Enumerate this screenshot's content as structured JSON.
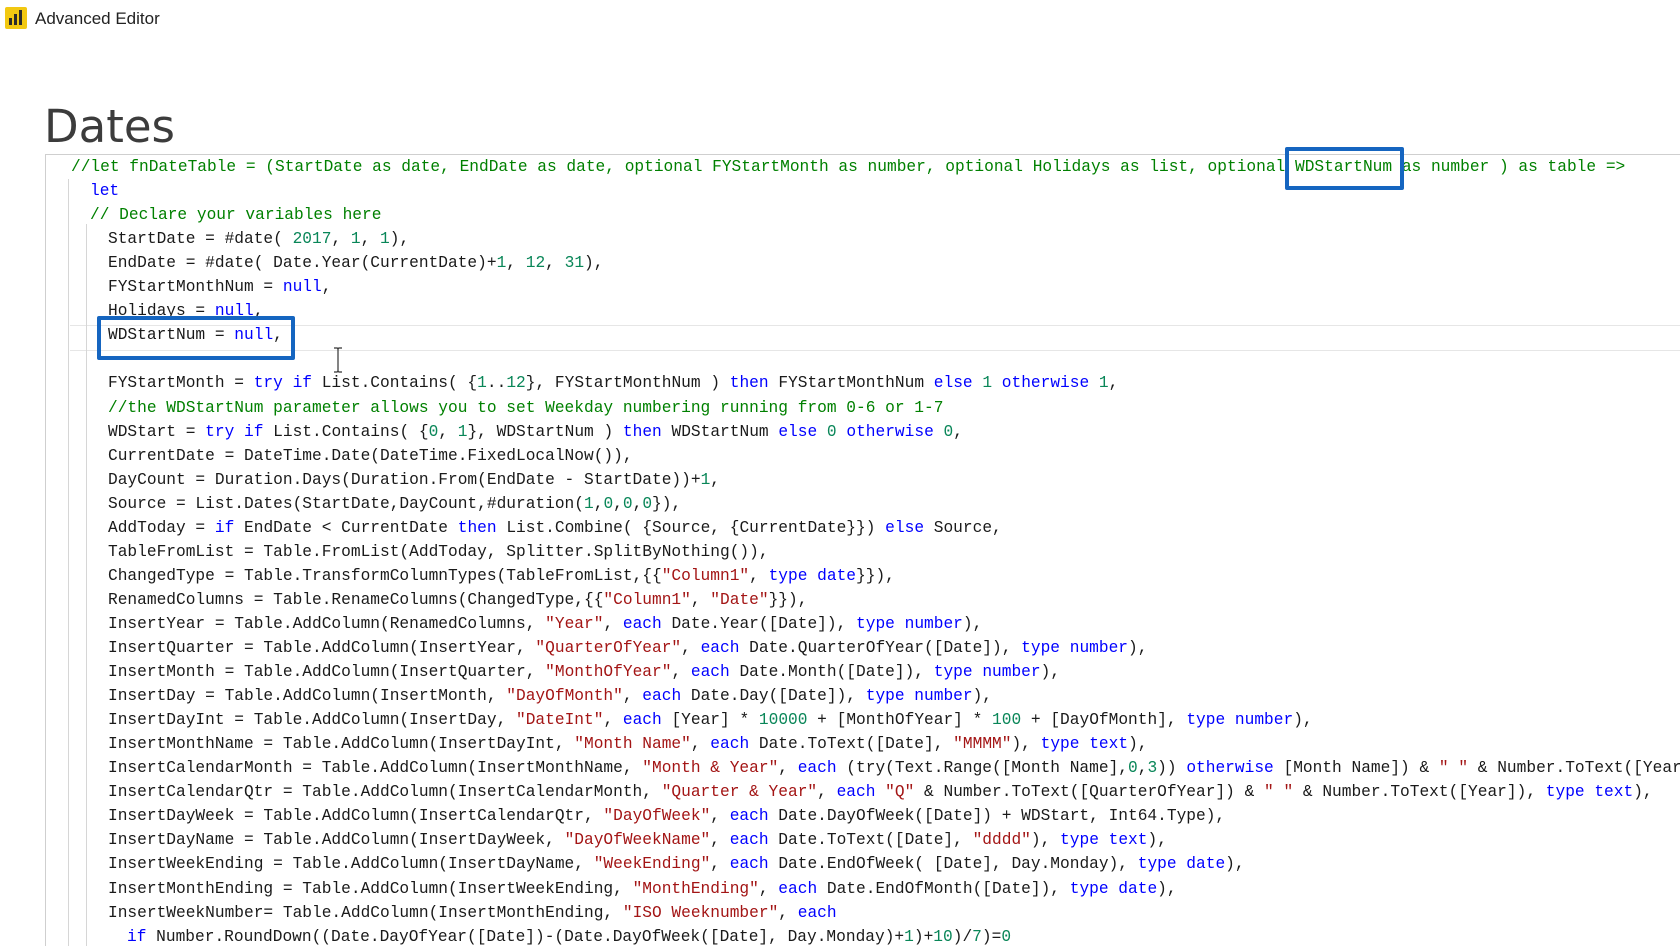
{
  "window": {
    "title": "Advanced Editor",
    "icon": "power-bi-icon",
    "accent_color": "#f2c811"
  },
  "page": {
    "title": "Dates"
  },
  "editor": {
    "highlight_color": "#1565c0",
    "lines": [
      {
        "indent": 0,
        "tokens": [
          [
            "cm",
            "//let fnDateTable = (StartDate as date, EndDate as date, optional FYStartMonth as number, optional Holidays as list, optional WDStartNum as number ) as table =>"
          ]
        ]
      },
      {
        "indent": 1,
        "tokens": [
          [
            "kw",
            "let"
          ]
        ]
      },
      {
        "indent": 1,
        "tokens": [
          [
            "cm",
            "// Declare your variables here"
          ]
        ]
      },
      {
        "indent": 2,
        "tokens": [
          [
            "tx",
            "StartDate = #date( "
          ],
          [
            "nm",
            "2017"
          ],
          [
            "tx",
            ", "
          ],
          [
            "nm",
            "1"
          ],
          [
            "tx",
            ", "
          ],
          [
            "nm",
            "1"
          ],
          [
            "tx",
            "),"
          ]
        ]
      },
      {
        "indent": 2,
        "tokens": [
          [
            "tx",
            "EndDate = #date( Date.Year(CurrentDate)+"
          ],
          [
            "nm",
            "1"
          ],
          [
            "tx",
            ", "
          ],
          [
            "nm",
            "12"
          ],
          [
            "tx",
            ", "
          ],
          [
            "nm",
            "31"
          ],
          [
            "tx",
            "),"
          ]
        ]
      },
      {
        "indent": 2,
        "tokens": [
          [
            "tx",
            "FYStartMonthNum = "
          ],
          [
            "kw",
            "null"
          ],
          [
            "tx",
            ","
          ]
        ]
      },
      {
        "indent": 2,
        "tokens": [
          [
            "tx",
            "Holidays = "
          ],
          [
            "kw",
            "null"
          ],
          [
            "tx",
            ","
          ]
        ]
      },
      {
        "indent": 2,
        "tokens": [
          [
            "tx",
            "WDStartNum = "
          ],
          [
            "kw",
            "null"
          ],
          [
            "tx",
            ","
          ]
        ]
      },
      {
        "indent": 2,
        "tokens": []
      },
      {
        "indent": 2,
        "tokens": [
          [
            "tx",
            "FYStartMonth = "
          ],
          [
            "kw",
            "try if "
          ],
          [
            "tx",
            "List.Contains( {"
          ],
          [
            "nm",
            "1"
          ],
          [
            "tx",
            ".."
          ],
          [
            "nm",
            "12"
          ],
          [
            "tx",
            "}, FYStartMonthNum ) "
          ],
          [
            "kw",
            "then "
          ],
          [
            "tx",
            "FYStartMonthNum "
          ],
          [
            "kw",
            "else "
          ],
          [
            "nm",
            "1"
          ],
          [
            "kw",
            " otherwise "
          ],
          [
            "nm",
            "1"
          ],
          [
            "tx",
            ","
          ]
        ]
      },
      {
        "indent": 2,
        "tokens": [
          [
            "cm",
            "//the WDStartNum parameter allows you to set Weekday numbering running from 0-6 or 1-7"
          ]
        ]
      },
      {
        "indent": 2,
        "tokens": [
          [
            "tx",
            "WDStart = "
          ],
          [
            "kw",
            "try if "
          ],
          [
            "tx",
            "List.Contains( {"
          ],
          [
            "nm",
            "0"
          ],
          [
            "tx",
            ", "
          ],
          [
            "nm",
            "1"
          ],
          [
            "tx",
            "}, WDStartNum ) "
          ],
          [
            "kw",
            "then "
          ],
          [
            "tx",
            "WDStartNum "
          ],
          [
            "kw",
            "else "
          ],
          [
            "nm",
            "0"
          ],
          [
            "kw",
            " otherwise "
          ],
          [
            "nm",
            "0"
          ],
          [
            "tx",
            ","
          ]
        ]
      },
      {
        "indent": 2,
        "tokens": [
          [
            "tx",
            "CurrentDate = DateTime.Date(DateTime.FixedLocalNow()),"
          ]
        ]
      },
      {
        "indent": 2,
        "tokens": [
          [
            "tx",
            "DayCount = Duration.Days(Duration.From(EndDate - StartDate))+"
          ],
          [
            "nm",
            "1"
          ],
          [
            "tx",
            ","
          ]
        ]
      },
      {
        "indent": 2,
        "tokens": [
          [
            "tx",
            "Source = List.Dates(StartDate,DayCount,#duration("
          ],
          [
            "nm",
            "1"
          ],
          [
            "tx",
            ","
          ],
          [
            "nm",
            "0"
          ],
          [
            "tx",
            ","
          ],
          [
            "nm",
            "0"
          ],
          [
            "tx",
            ","
          ],
          [
            "nm",
            "0"
          ],
          [
            "tx",
            "}),"
          ]
        ]
      },
      {
        "indent": 2,
        "tokens": [
          [
            "tx",
            "AddToday = "
          ],
          [
            "kw",
            "if "
          ],
          [
            "tx",
            "EndDate < CurrentDate "
          ],
          [
            "kw",
            "then "
          ],
          [
            "tx",
            "List.Combine( {Source, {CurrentDate}}) "
          ],
          [
            "kw",
            "else "
          ],
          [
            "tx",
            "Source,"
          ]
        ]
      },
      {
        "indent": 2,
        "tokens": [
          [
            "tx",
            "TableFromList = Table.FromList(AddToday, Splitter.SplitByNothing()),"
          ]
        ]
      },
      {
        "indent": 2,
        "tokens": [
          [
            "tx",
            "ChangedType = Table.TransformColumnTypes(TableFromList,{{"
          ],
          [
            "st",
            "\"Column1\""
          ],
          [
            "tx",
            ", "
          ],
          [
            "kw",
            "type date"
          ],
          [
            "tx",
            "}}),"
          ]
        ]
      },
      {
        "indent": 2,
        "tokens": [
          [
            "tx",
            "RenamedColumns = Table.RenameColumns(ChangedType,{{"
          ],
          [
            "st",
            "\"Column1\""
          ],
          [
            "tx",
            ", "
          ],
          [
            "st",
            "\"Date\""
          ],
          [
            "tx",
            "}}),"
          ]
        ]
      },
      {
        "indent": 2,
        "tokens": [
          [
            "tx",
            "InsertYear = Table.AddColumn(RenamedColumns, "
          ],
          [
            "st",
            "\"Year\""
          ],
          [
            "tx",
            ", "
          ],
          [
            "kw",
            "each "
          ],
          [
            "tx",
            "Date.Year([Date]), "
          ],
          [
            "kw",
            "type number"
          ],
          [
            "tx",
            "),"
          ]
        ]
      },
      {
        "indent": 2,
        "tokens": [
          [
            "tx",
            "InsertQuarter = Table.AddColumn(InsertYear, "
          ],
          [
            "st",
            "\"QuarterOfYear\""
          ],
          [
            "tx",
            ", "
          ],
          [
            "kw",
            "each "
          ],
          [
            "tx",
            "Date.QuarterOfYear([Date]), "
          ],
          [
            "kw",
            "type number"
          ],
          [
            "tx",
            "),"
          ]
        ]
      },
      {
        "indent": 2,
        "tokens": [
          [
            "tx",
            "InsertMonth = Table.AddColumn(InsertQuarter, "
          ],
          [
            "st",
            "\"MonthOfYear\""
          ],
          [
            "tx",
            ", "
          ],
          [
            "kw",
            "each "
          ],
          [
            "tx",
            "Date.Month([Date]), "
          ],
          [
            "kw",
            "type number"
          ],
          [
            "tx",
            "),"
          ]
        ]
      },
      {
        "indent": 2,
        "tokens": [
          [
            "tx",
            "InsertDay = Table.AddColumn(InsertMonth, "
          ],
          [
            "st",
            "\"DayOfMonth\""
          ],
          [
            "tx",
            ", "
          ],
          [
            "kw",
            "each "
          ],
          [
            "tx",
            "Date.Day([Date]), "
          ],
          [
            "kw",
            "type number"
          ],
          [
            "tx",
            "),"
          ]
        ]
      },
      {
        "indent": 2,
        "tokens": [
          [
            "tx",
            "InsertDayInt = Table.AddColumn(InsertDay, "
          ],
          [
            "st",
            "\"DateInt\""
          ],
          [
            "tx",
            ", "
          ],
          [
            "kw",
            "each "
          ],
          [
            "tx",
            "[Year] * "
          ],
          [
            "nm",
            "10000"
          ],
          [
            "tx",
            " + [MonthOfYear] * "
          ],
          [
            "nm",
            "100"
          ],
          [
            "tx",
            " + [DayOfMonth], "
          ],
          [
            "kw",
            "type number"
          ],
          [
            "tx",
            "),"
          ]
        ]
      },
      {
        "indent": 2,
        "tokens": [
          [
            "tx",
            "InsertMonthName = Table.AddColumn(InsertDayInt, "
          ],
          [
            "st",
            "\"Month Name\""
          ],
          [
            "tx",
            ", "
          ],
          [
            "kw",
            "each "
          ],
          [
            "tx",
            "Date.ToText([Date], "
          ],
          [
            "st",
            "\"MMMM\""
          ],
          [
            "tx",
            "), "
          ],
          [
            "kw",
            "type text"
          ],
          [
            "tx",
            "),"
          ]
        ]
      },
      {
        "indent": 2,
        "tokens": [
          [
            "tx",
            "InsertCalendarMonth = Table.AddColumn(InsertMonthName, "
          ],
          [
            "st",
            "\"Month & Year\""
          ],
          [
            "tx",
            ", "
          ],
          [
            "kw",
            "each "
          ],
          [
            "tx",
            "(try(Text.Range([Month Name],"
          ],
          [
            "nm",
            "0"
          ],
          [
            "tx",
            ","
          ],
          [
            "nm",
            "3"
          ],
          [
            "tx",
            ")) "
          ],
          [
            "kw",
            "otherwise "
          ],
          [
            "tx",
            "[Month Name]) & "
          ],
          [
            "st",
            "\" \""
          ],
          [
            "tx",
            " & Number.ToText([Year"
          ]
        ]
      },
      {
        "indent": 2,
        "tokens": [
          [
            "tx",
            "InsertCalendarQtr = Table.AddColumn(InsertCalendarMonth, "
          ],
          [
            "st",
            "\"Quarter & Year\""
          ],
          [
            "tx",
            ", "
          ],
          [
            "kw",
            "each "
          ],
          [
            "st",
            "\"Q\""
          ],
          [
            "tx",
            " & Number.ToText([QuarterOfYear]) & "
          ],
          [
            "st",
            "\" \""
          ],
          [
            "tx",
            " & Number.ToText([Year]), "
          ],
          [
            "kw",
            "type text"
          ],
          [
            "tx",
            "),"
          ]
        ]
      },
      {
        "indent": 2,
        "tokens": [
          [
            "tx",
            "InsertDayWeek = Table.AddColumn(InsertCalendarQtr, "
          ],
          [
            "st",
            "\"DayOfWeek\""
          ],
          [
            "tx",
            ", "
          ],
          [
            "kw",
            "each "
          ],
          [
            "tx",
            "Date.DayOfWeek([Date]) + WDStart, Int64.Type),"
          ]
        ]
      },
      {
        "indent": 2,
        "tokens": [
          [
            "tx",
            "InsertDayName = Table.AddColumn(InsertDayWeek, "
          ],
          [
            "st",
            "\"DayOfWeekName\""
          ],
          [
            "tx",
            ", "
          ],
          [
            "kw",
            "each "
          ],
          [
            "tx",
            "Date.ToText([Date], "
          ],
          [
            "st",
            "\"dddd\""
          ],
          [
            "tx",
            "), "
          ],
          [
            "kw",
            "type text"
          ],
          [
            "tx",
            "),"
          ]
        ]
      },
      {
        "indent": 2,
        "tokens": [
          [
            "tx",
            "InsertWeekEnding = Table.AddColumn(InsertDayName, "
          ],
          [
            "st",
            "\"WeekEnding\""
          ],
          [
            "tx",
            ", "
          ],
          [
            "kw",
            "each "
          ],
          [
            "tx",
            "Date.EndOfWeek( [Date], Day.Monday), "
          ],
          [
            "kw",
            "type date"
          ],
          [
            "tx",
            "),"
          ]
        ]
      },
      {
        "indent": 2,
        "tokens": [
          [
            "tx",
            "InsertMonthEnding = Table.AddColumn(InsertWeekEnding, "
          ],
          [
            "st",
            "\"MonthEnding\""
          ],
          [
            "tx",
            ", "
          ],
          [
            "kw",
            "each "
          ],
          [
            "tx",
            "Date.EndOfMonth([Date]), "
          ],
          [
            "kw",
            "type date"
          ],
          [
            "tx",
            "),"
          ]
        ]
      },
      {
        "indent": 2,
        "tokens": [
          [
            "tx",
            "InsertWeekNumber= Table.AddColumn(InsertMonthEnding, "
          ],
          [
            "st",
            "\"ISO Weeknumber\""
          ],
          [
            "tx",
            ", "
          ],
          [
            "kw",
            "each"
          ]
        ]
      },
      {
        "indent": 3,
        "tokens": [
          [
            "kw",
            "if "
          ],
          [
            "tx",
            "Number.RoundDown((Date.DayOfYear([Date])-(Date.DayOfWeek([Date], Day.Monday)+"
          ],
          [
            "nm",
            "1"
          ],
          [
            "tx",
            ")+"
          ],
          [
            "nm",
            "10"
          ],
          [
            "tx",
            ")/"
          ],
          [
            "nm",
            "7"
          ],
          [
            "tx",
            ")="
          ],
          [
            "nm",
            "0"
          ]
        ]
      }
    ]
  }
}
